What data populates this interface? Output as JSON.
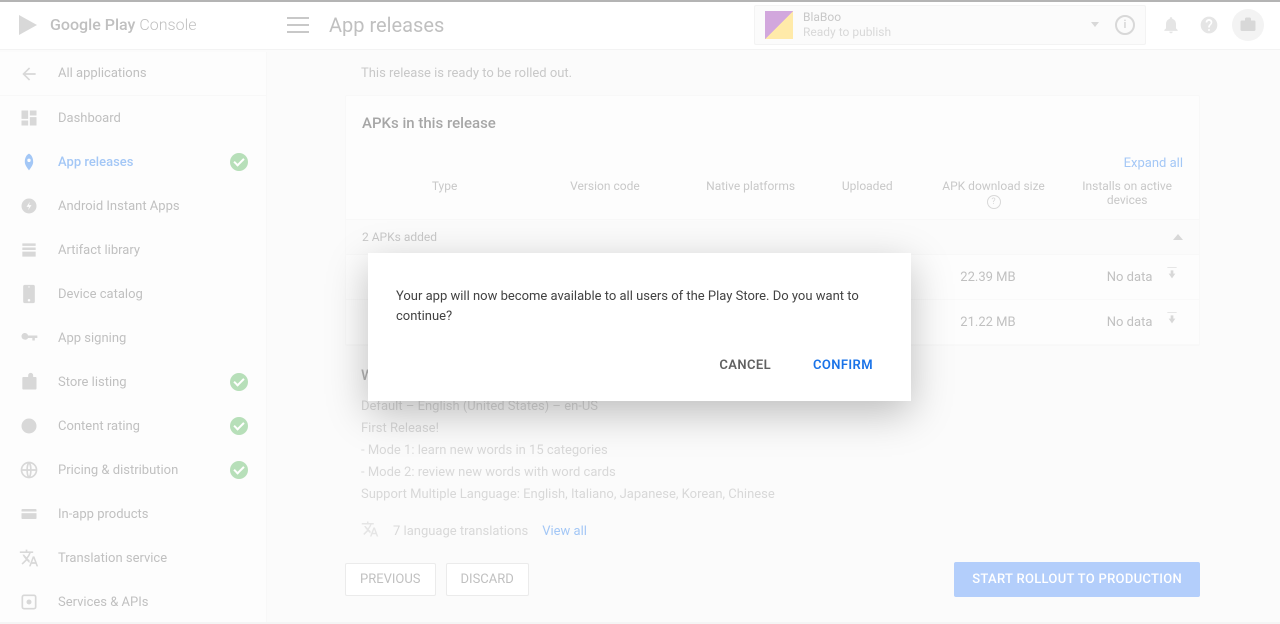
{
  "header": {
    "logo_brand": "Google Play",
    "logo_suffix": "Console",
    "page_title": "App releases",
    "app_name": "BlaBoo",
    "app_status": "Ready to publish"
  },
  "sidebar": {
    "back": "All applications",
    "items": [
      {
        "label": "Dashboard",
        "checked": false
      },
      {
        "label": "App releases",
        "checked": true,
        "selected": true
      },
      {
        "label": "Android Instant Apps",
        "checked": false
      },
      {
        "label": "Artifact library",
        "checked": false
      },
      {
        "label": "Device catalog",
        "checked": false
      },
      {
        "label": "App signing",
        "checked": false
      },
      {
        "label": "Store listing",
        "checked": true
      },
      {
        "label": "Content rating",
        "checked": true
      },
      {
        "label": "Pricing & distribution",
        "checked": true
      },
      {
        "label": "In-app products",
        "checked": false
      },
      {
        "label": "Translation service",
        "checked": false
      },
      {
        "label": "Services & APIs",
        "checked": false
      }
    ]
  },
  "release": {
    "ready_note": "This release is ready to be rolled out.",
    "apk_section_title": "APKs in this release",
    "expand_all": "Expand all",
    "columns": {
      "type": "Type",
      "version": "Version code",
      "platforms": "Native platforms",
      "uploaded": "Uploaded",
      "size": "APK download size",
      "installs": "Installs on active devices"
    },
    "added_summary": "2 APKs added",
    "rows": [
      {
        "size": "22.39 MB",
        "installs": "No data"
      },
      {
        "size": "21.22 MB",
        "installs": "No data"
      }
    ],
    "whats_new_title": "What's new in this release?",
    "notes": {
      "lang_line": "Default – English (United States) – en-US",
      "line1": "First Release!",
      "line2": " - Mode 1: learn new words in 15 categories",
      "line3": " - Mode 2: review new words with word cards",
      "line4": "Support Multiple Language: English, Italiano, Japanese, Korean, Chinese"
    },
    "translations_count": "7 language translations",
    "view_all": "View all"
  },
  "buttons": {
    "previous": "PREVIOUS",
    "discard": "DISCARD",
    "start_rollout": "START ROLLOUT TO PRODUCTION"
  },
  "dialog": {
    "message": "Your app will now become available to all users of the Play Store. Do you want to continue?",
    "cancel": "CANCEL",
    "confirm": "CONFIRM"
  }
}
